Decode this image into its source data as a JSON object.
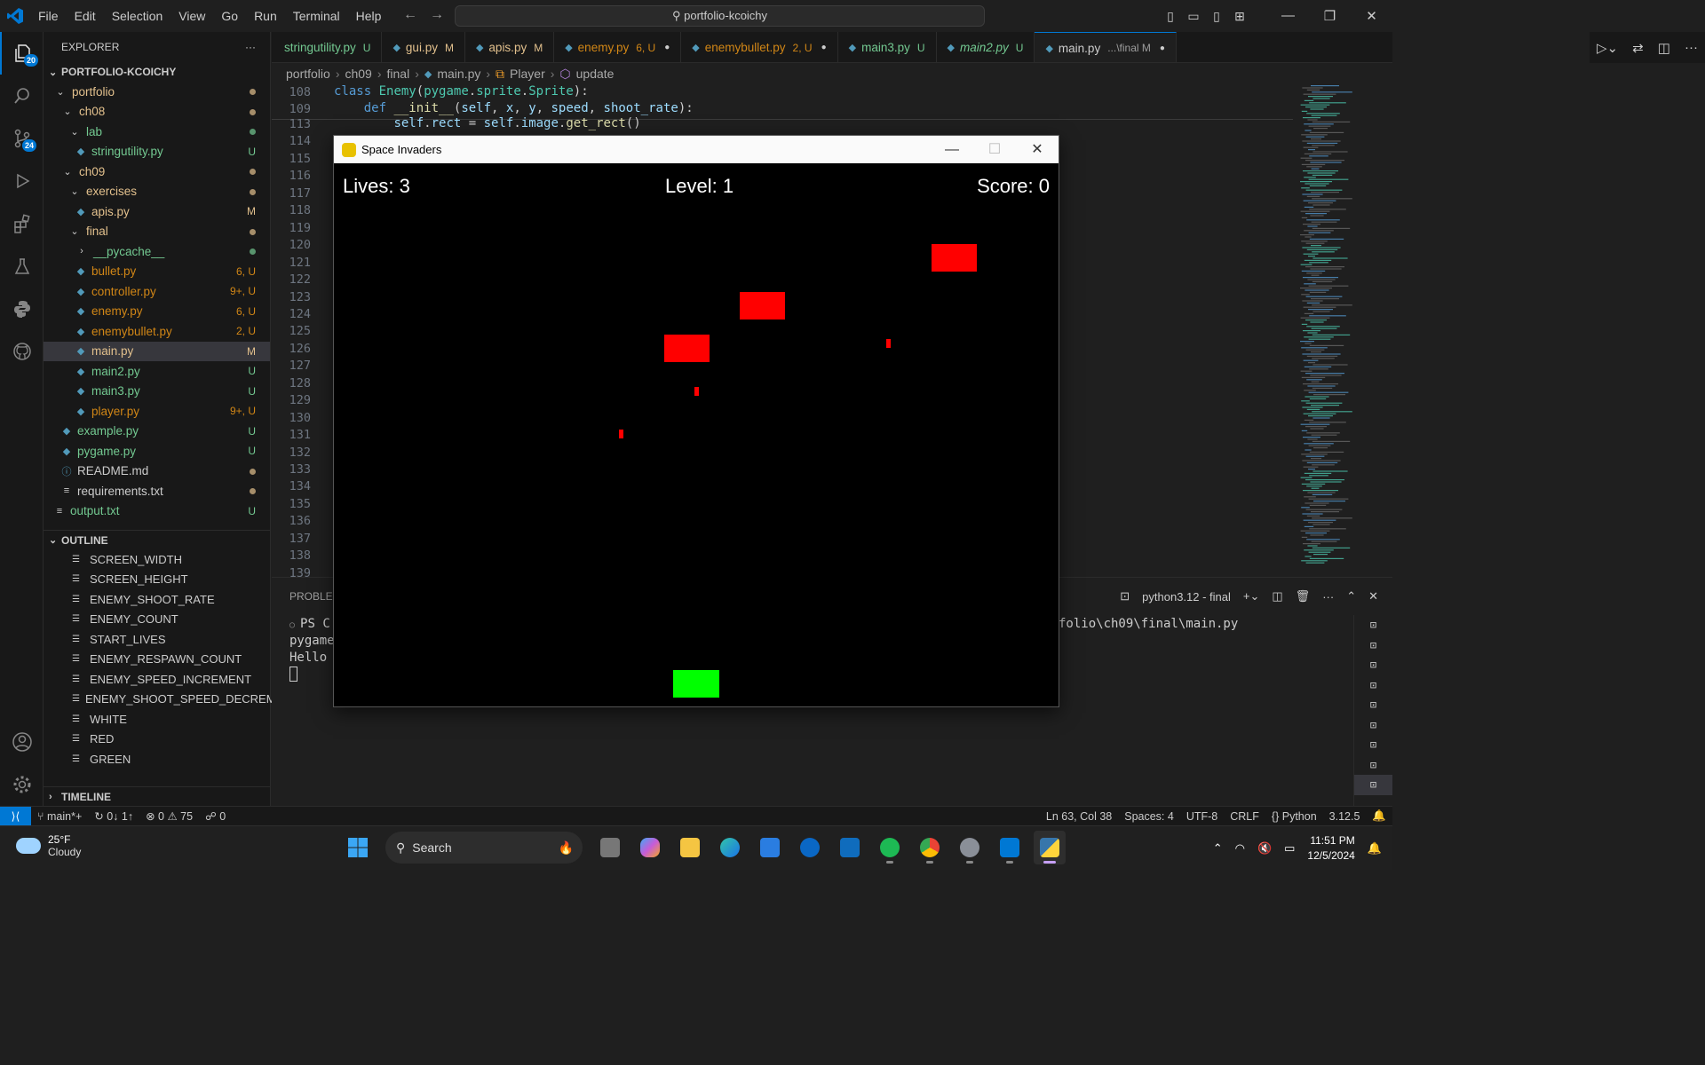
{
  "menu": [
    "File",
    "Edit",
    "Selection",
    "View",
    "Go",
    "Run",
    "Terminal",
    "Help"
  ],
  "command_center": "portfolio-kcoichy",
  "activity_badges": {
    "explorer": "20",
    "source_control": "24"
  },
  "explorer": {
    "title": "EXPLORER",
    "root": "PORTFOLIO-KCOICHY",
    "items": [
      {
        "label": "portfolio",
        "indent": 1,
        "type": "folder",
        "status": "",
        "color": "yellow"
      },
      {
        "label": "ch08",
        "indent": 2,
        "type": "folder",
        "status": "",
        "color": "yellow"
      },
      {
        "label": "lab",
        "indent": 3,
        "type": "folder",
        "status": "",
        "color": "green"
      },
      {
        "label": "stringutility.py",
        "indent": 4,
        "type": "file",
        "status": "U",
        "color": "green"
      },
      {
        "label": "ch09",
        "indent": 2,
        "type": "folder",
        "status": "",
        "color": "yellow"
      },
      {
        "label": "exercises",
        "indent": 3,
        "type": "folder",
        "status": "",
        "color": "yellow"
      },
      {
        "label": "apis.py",
        "indent": 4,
        "type": "file",
        "status": "M",
        "color": "yellow"
      },
      {
        "label": "final",
        "indent": 3,
        "type": "folder",
        "status": "",
        "color": "yellow"
      },
      {
        "label": "__pycache__",
        "indent": 4,
        "type": "folder-closed",
        "status": "",
        "color": "green"
      },
      {
        "label": "bullet.py",
        "indent": 4,
        "type": "file",
        "status": "6, U",
        "color": "orange"
      },
      {
        "label": "controller.py",
        "indent": 4,
        "type": "file",
        "status": "9+, U",
        "color": "orange"
      },
      {
        "label": "enemy.py",
        "indent": 4,
        "type": "file",
        "status": "6, U",
        "color": "orange"
      },
      {
        "label": "enemybullet.py",
        "indent": 4,
        "type": "file",
        "status": "2, U",
        "color": "orange"
      },
      {
        "label": "main.py",
        "indent": 4,
        "type": "file",
        "status": "M",
        "color": "yellow"
      },
      {
        "label": "main2.py",
        "indent": 4,
        "type": "file",
        "status": "U",
        "color": "green"
      },
      {
        "label": "main3.py",
        "indent": 4,
        "type": "file",
        "status": "U",
        "color": "green"
      },
      {
        "label": "player.py",
        "indent": 4,
        "type": "file",
        "status": "9+, U",
        "color": "orange"
      },
      {
        "label": "example.py",
        "indent": 2,
        "type": "file",
        "status": "U",
        "color": "green"
      },
      {
        "label": "pygame.py",
        "indent": 2,
        "type": "file",
        "status": "U",
        "color": "green"
      },
      {
        "label": "README.md",
        "indent": 2,
        "type": "info",
        "status": "",
        "color": "plain"
      },
      {
        "label": "requirements.txt",
        "indent": 2,
        "type": "text",
        "status": "",
        "color": "plain"
      },
      {
        "label": "output.txt",
        "indent": 1,
        "type": "text",
        "status": "U",
        "color": "green"
      }
    ]
  },
  "outline": {
    "title": "OUTLINE",
    "items": [
      "SCREEN_WIDTH",
      "SCREEN_HEIGHT",
      "ENEMY_SHOOT_RATE",
      "ENEMY_COUNT",
      "START_LIVES",
      "ENEMY_RESPAWN_COUNT",
      "ENEMY_SPEED_INCREMENT",
      "ENEMY_SHOOT_SPEED_DECREM...",
      "WHITE",
      "RED",
      "GREEN"
    ]
  },
  "timeline": "TIMELINE",
  "tabs": [
    {
      "label": "stringutility.py",
      "status": "U",
      "color": "green"
    },
    {
      "label": "gui.py",
      "status": "M",
      "color": "yellow"
    },
    {
      "label": "apis.py",
      "status": "M",
      "color": "yellow"
    },
    {
      "label": "enemy.py",
      "status": "6, U",
      "color": "orange"
    },
    {
      "label": "enemybullet.py",
      "status": "2, U",
      "color": "orange"
    },
    {
      "label": "main3.py",
      "status": "U",
      "color": "green"
    },
    {
      "label": "main2.py",
      "status": "U",
      "color": "green"
    },
    {
      "label": "main.py",
      "status": "...\\final M",
      "color": "plain"
    }
  ],
  "breadcrumb": [
    "portfolio",
    "ch09",
    "final",
    "main.py",
    "Player",
    "update"
  ],
  "editor": {
    "sticky": [
      {
        "ln": "108",
        "code": "class Enemy(pygame.sprite.Sprite):"
      },
      {
        "ln": "109",
        "code": "    def __init__(self, x, y, speed, shoot_rate):"
      }
    ],
    "line113": "        self.rect = self.image.get_rect()",
    "line_numbers": [
      "113",
      "114",
      "115",
      "116",
      "117",
      "118",
      "119",
      "120",
      "121",
      "122",
      "123",
      "124",
      "125",
      "126",
      "127",
      "128",
      "129",
      "130",
      "131",
      "132",
      "133",
      "134",
      "135",
      "136",
      "137",
      "138",
      "139"
    ]
  },
  "panel": {
    "tab": "PROBLEM",
    "terminal_name": "python3.12 - final",
    "lines": [
      "PS C:\\U",
      "pygame",
      "Hello f"
    ],
    "path_tail": "folio\\ch09\\final\\main.py"
  },
  "game": {
    "title": "Space Invaders",
    "lives": "Lives: 3",
    "level": "Level: 1",
    "score": "Score: 0"
  },
  "statusbar": {
    "branch": "main*+",
    "sync": "0↓ 1↑",
    "errors": "0",
    "warnings": "75",
    "ports": "0",
    "position": "Ln 63, Col 38",
    "spaces": "Spaces: 4",
    "encoding": "UTF-8",
    "eol": "CRLF",
    "language": "Python",
    "version": "3.12.5"
  },
  "taskbar": {
    "temp": "25°F",
    "weather": "Cloudy",
    "search": "Search",
    "time": "11:51 PM",
    "date": "12/5/2024"
  },
  "colors": {
    "accent": "#0078d4",
    "enemy": "#ff0000",
    "player": "#00ff00"
  }
}
